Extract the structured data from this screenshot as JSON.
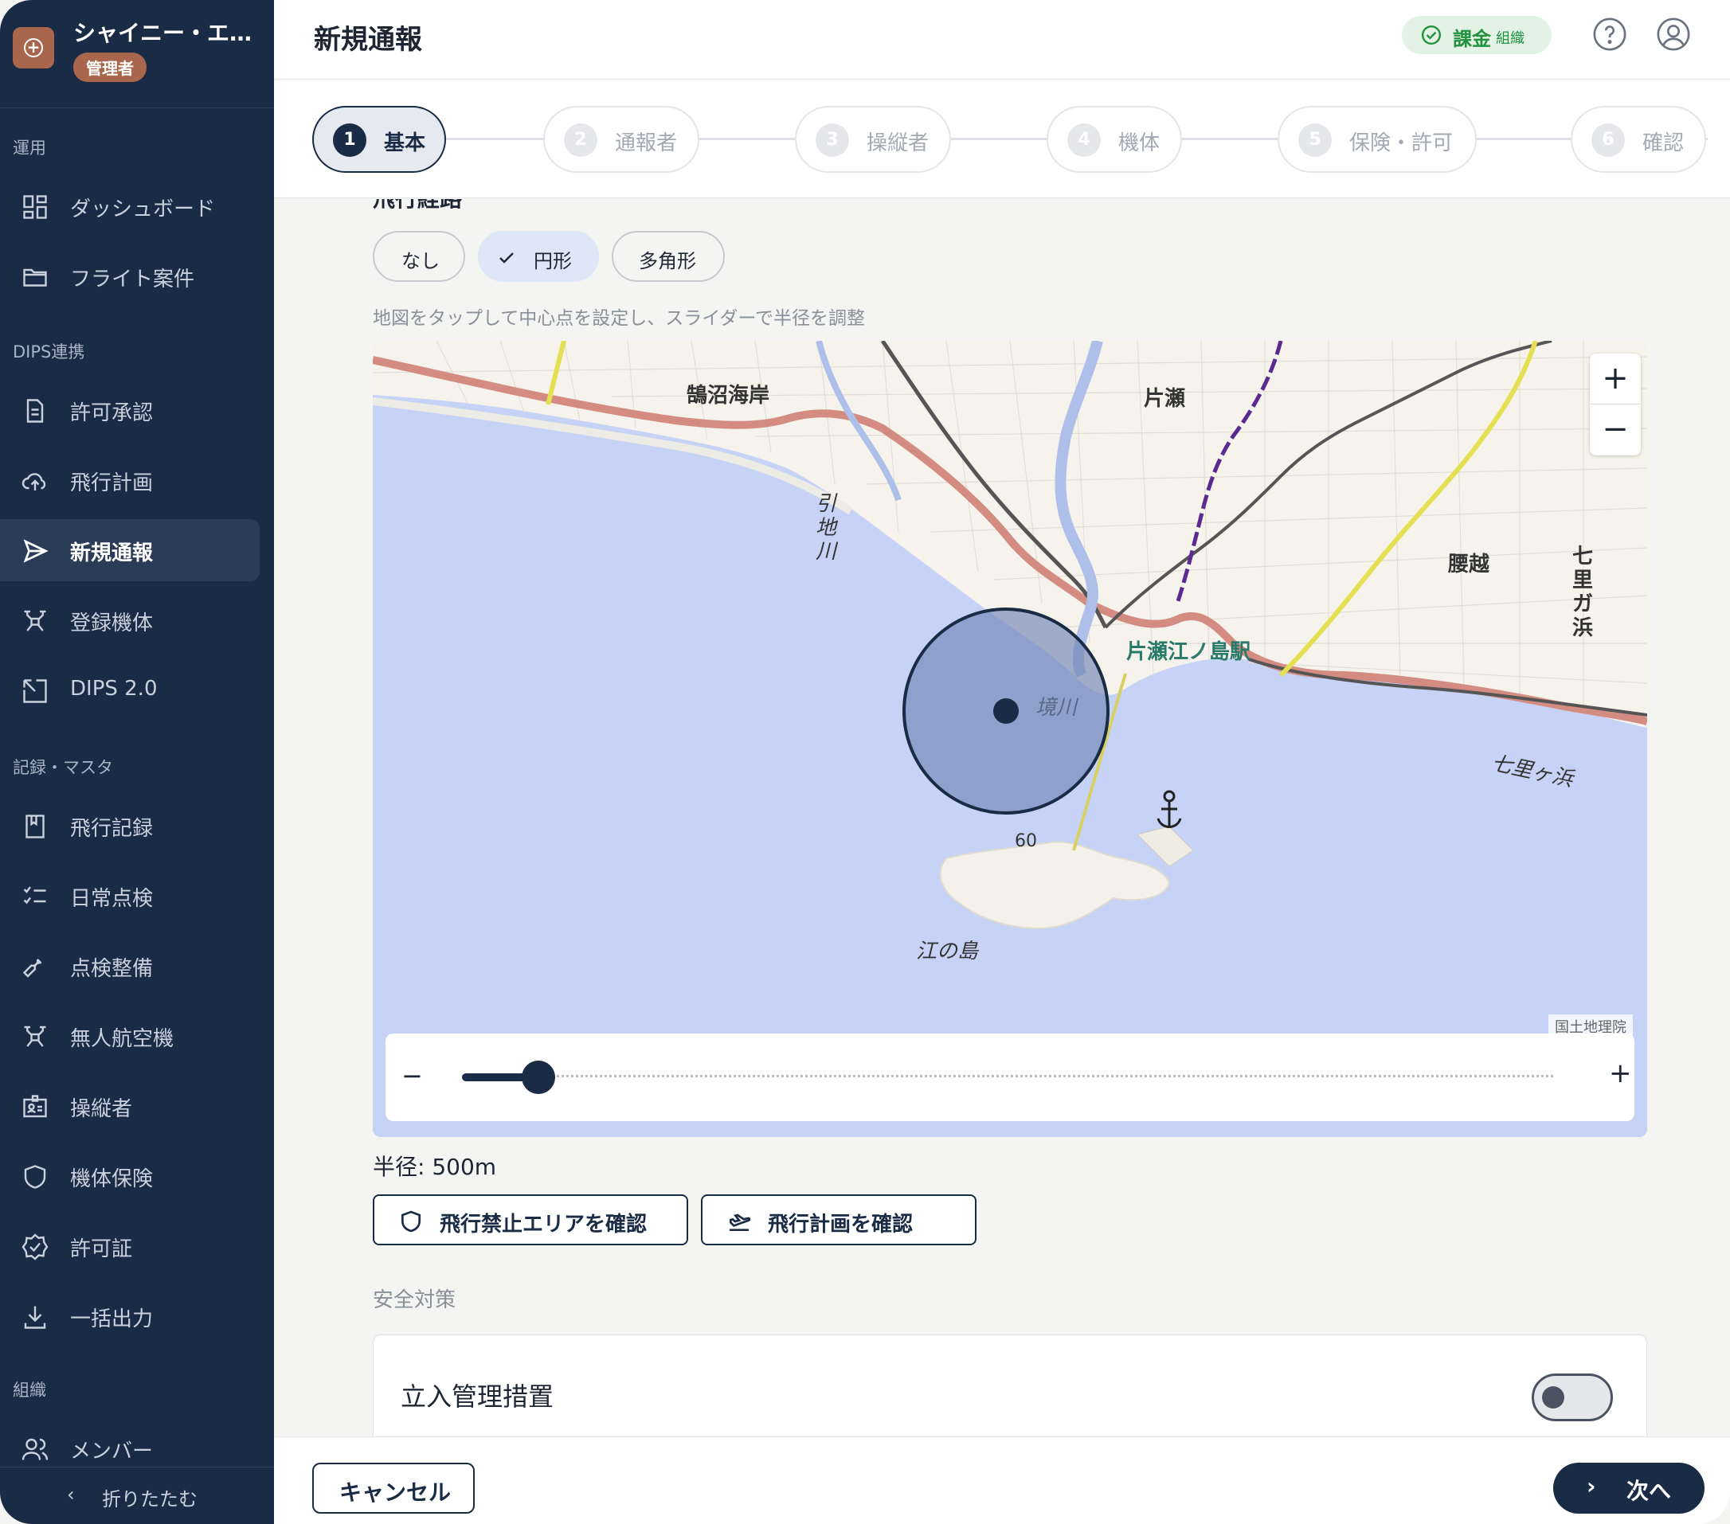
{
  "sidebar": {
    "org_name": "シャイニー・エ…",
    "org_role": "管理者",
    "sections": {
      "ops": "運用",
      "dips": "DIPS連携",
      "records": "記録・マスタ",
      "org": "組織"
    },
    "items": {
      "dashboard": "ダッシュボード",
      "flight_cases": "フライト案件",
      "permit_approval": "許可承認",
      "flight_plan": "飛行計画",
      "new_report": "新規通報",
      "registered_aircraft": "登録機体",
      "dips2": "DIPS 2.0",
      "flight_log": "飛行記録",
      "daily_inspection": "日常点検",
      "maintenance": "点検整備",
      "uav": "無人航空機",
      "operators": "操縦者",
      "insurance": "機体保険",
      "permits": "許可証",
      "bulk_export": "一括出力",
      "members": "メンバー"
    },
    "active_item": "new_report",
    "collapse_label": "折りたたむ"
  },
  "header": {
    "title": "新規通報",
    "billing_label": "課金",
    "billing_sub": "組織"
  },
  "stepper": {
    "steps": [
      {
        "num": "1",
        "label": "基本"
      },
      {
        "num": "2",
        "label": "通報者"
      },
      {
        "num": "3",
        "label": "操縦者"
      },
      {
        "num": "4",
        "label": "機体"
      },
      {
        "num": "5",
        "label": "保険・許可"
      },
      {
        "num": "6",
        "label": "確認"
      }
    ],
    "active_index": 0
  },
  "form": {
    "cut_label": "飛行経路",
    "shape_options": [
      "なし",
      "円形",
      "多角形"
    ],
    "selected_shape": "円形",
    "hint": "地図をタップして中心点を設定し、スライダーで半径を調整",
    "map": {
      "labels": {
        "kugenuma": "鵠沼海岸",
        "katase": "片瀬",
        "hikiji": "引地川",
        "koshigoe": "腰越",
        "shichirigahama_v": "七里ガ浜",
        "station": "片瀬江ノ島駅",
        "sakaigawa": "境川",
        "shichirigahama_bay": "七里ヶ浜",
        "enoshima": "江の島",
        "elevation": "60"
      },
      "zoom_in": "+",
      "zoom_out": "−",
      "attribution": "国土地理院"
    },
    "slider": {
      "minus": "−",
      "plus": "+",
      "fraction": 0.07
    },
    "radius_text": "半径: 500m",
    "check_no_fly": "飛行禁止エリアを確認",
    "check_flight_plan": "飛行計画を確認",
    "safety_title": "安全対策",
    "entry_control": "立入管理措置",
    "entry_control_on": false
  },
  "footer": {
    "cancel": "キャンセル",
    "next": "次へ"
  },
  "colors": {
    "sidebar_bg": "#1a2b45",
    "accent": "#1a2b45",
    "billing_green": "#22913e",
    "sea": "#c7d3f6",
    "land": "#f5f3ec"
  }
}
